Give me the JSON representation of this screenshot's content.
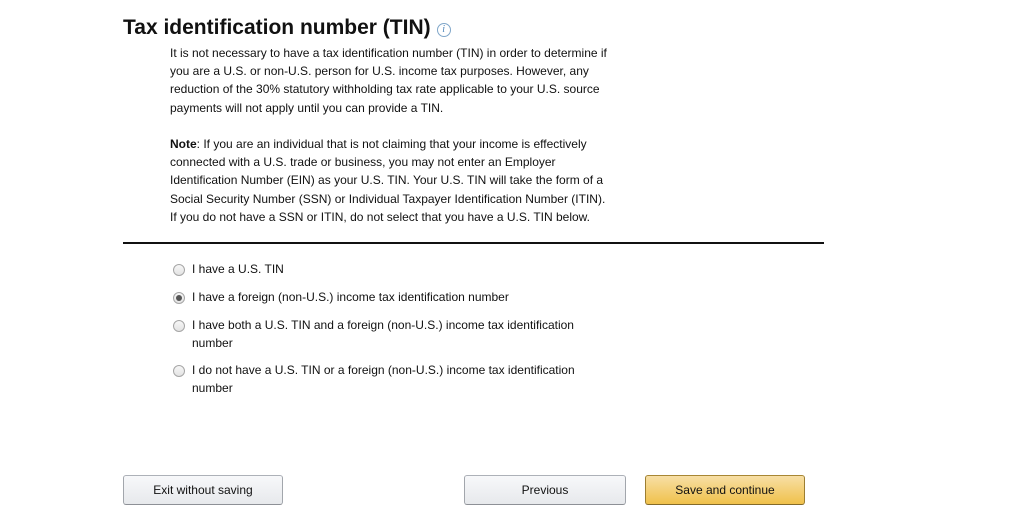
{
  "section": {
    "title": "Tax identification number (TIN)",
    "info_icon": "i",
    "intro": "It is not necessary to have a tax identification number (TIN) in order to determine if you are a U.S. or non-U.S. person for U.S. income tax purposes. However, any reduction of the 30% statutory withholding tax rate applicable to your U.S. source payments will not apply until you can provide a TIN.",
    "note_label": "Note",
    "note_text": ": If you are an individual that is not claiming that your income is effectively connected with a U.S. trade or business, you may not enter an Employer Identification Number (EIN) as your U.S. TIN. Your U.S. TIN will take the form of a Social Security Number (SSN) or Individual Taxpayer Identification Number (ITIN). If you do not have a SSN or ITIN, do not select that you have a U.S. TIN below."
  },
  "options": [
    {
      "label": "I have a U.S. TIN",
      "selected": false
    },
    {
      "label": "I have a foreign (non-U.S.) income tax identification number",
      "selected": true
    },
    {
      "label": "I have both a U.S. TIN and a foreign (non-U.S.) income tax identification number",
      "selected": false
    },
    {
      "label": "I do not have a U.S. TIN or a foreign (non-U.S.) income tax identification number",
      "selected": false
    }
  ],
  "buttons": {
    "exit": "Exit without saving",
    "previous": "Previous",
    "save": "Save and continue"
  },
  "colors": {
    "primary_button": "#f0c14b",
    "primary_border": "#a88734",
    "info_icon": "#4f86bb"
  }
}
